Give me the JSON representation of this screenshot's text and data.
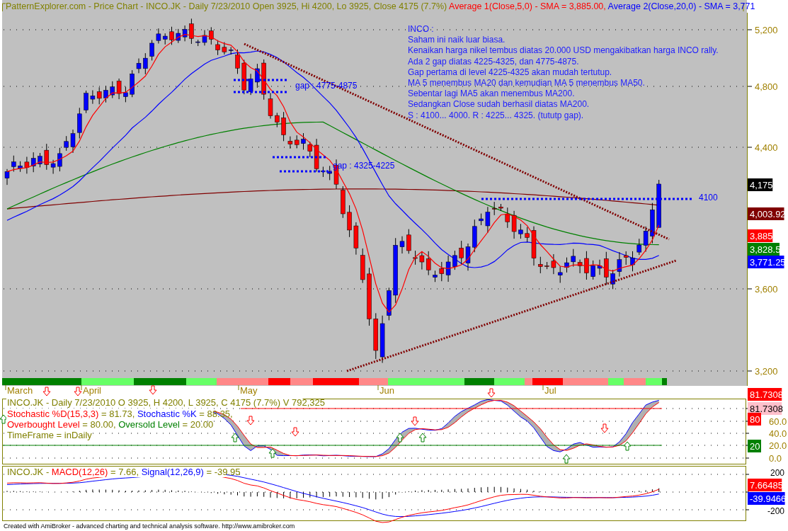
{
  "title_segments": [
    {
      "text": "PatternExplorer.com - Price Chart - INCO.JK - Daily 7/23/2010 Open 3925, Hi 4200, Lo 3925, Close 4175 (7.7%)",
      "color": "#808000"
    },
    {
      "text": " Average 1(Close,5,0) - SMA = 3,885.00,",
      "color": "#ff0000"
    },
    {
      "text": " Average 2(Close,20,0) - SMA = 3,771",
      "color": "#0000ff"
    }
  ],
  "price_panel": {
    "note_lines": [
      "INCO :",
      "Saham ini naik luar biasa.",
      "Kenaikan harga nikel tembus diatas 20.000 USD mengakibatkan harga INCO rally.",
      "Ada 2 gap diatas 4225-4325, dan 4775-4875.",
      "Gap pertama di level 4225-4325 akan mudah tertutup.",
      "MA 5 menembus MA20 dan kemudian MA 5 menembus MA50.",
      "Sebentar lagi MA5 akan menembus MA200.",
      "Sedangkan Close sudah berhasil diatas MA200.",
      "S : 4100... 4000. R : 4225... 4325. (tututp gap)."
    ],
    "gap_labels": [
      "gap : 4775-4875",
      "gap : 4325-4225"
    ],
    "level_label": "4100",
    "y_ticks": [
      "5,200",
      "4,800",
      "4,400",
      "3,600",
      "3,200"
    ],
    "value_badges": [
      {
        "text": "4,175",
        "color": "#000000"
      },
      {
        "text": "4,003.92",
        "color": "#800000"
      },
      {
        "text": "3,885",
        "color": "#ff0000"
      },
      {
        "text": "3,828.5",
        "color": "#008000"
      },
      {
        "text": "3,771.25",
        "color": "#0000ff"
      }
    ]
  },
  "month_labels": [
    "March",
    "April",
    "May",
    "Jun",
    "Jul"
  ],
  "stochastic_panel": {
    "legend_lines": [
      [
        {
          "text": "INCO.JK - Daily 7/23/2010 O 3925, H 4200, L 3925, C 4175 (7.7%) V 792,325",
          "color": "#808000"
        }
      ],
      [
        {
          "text": "Stochastic %D(15,3,3)",
          "color": "#ff0000"
        },
        {
          "text": " = 81.73, ",
          "color": "#808000"
        },
        {
          "text": "Stochastic %K",
          "color": "#0000ff"
        },
        {
          "text": " = 88.35,",
          "color": "#808000"
        }
      ],
      [
        {
          "text": "Overbought Level",
          "color": "#ff0000"
        },
        {
          "text": " = 80.00, ",
          "color": "#808000"
        },
        {
          "text": "Oversold Level",
          "color": "#008000"
        },
        {
          "text": " = 20.00",
          "color": "#808000"
        }
      ],
      [
        {
          "text": "TimeFrame = inDaily",
          "color": "#808000"
        }
      ]
    ],
    "y_ticks": [
      "60.0",
      "40.0",
      "20.0",
      "0.0"
    ],
    "value_badges": [
      {
        "text": "81.7308",
        "color": "#ff0000"
      },
      {
        "text": "81.7308",
        "color": "#ffc0cb"
      },
      {
        "text": "80",
        "color": "#ff0000"
      },
      {
        "text": "20",
        "color": "#008000"
      }
    ]
  },
  "macd_panel": {
    "legend_segments": [
      {
        "text": "INCO.JK - ",
        "color": "#808000"
      },
      {
        "text": "MACD(12,26)",
        "color": "#ff0000"
      },
      {
        "text": " = 7.66, ",
        "color": "#808000"
      },
      {
        "text": "Signal(12,26,9)",
        "color": "#0000ff"
      },
      {
        "text": " = -39.95",
        "color": "#808000"
      }
    ],
    "y_ticks": [
      "200",
      "-200"
    ],
    "value_badges": [
      {
        "text": "7.66485",
        "color": "#ff0000"
      },
      {
        "text": "-39.9466",
        "color": "#0000ff"
      }
    ]
  },
  "footer": "Created with AmiBroker - advanced charting and technical analysis software. http://www.amibroker.com"
}
